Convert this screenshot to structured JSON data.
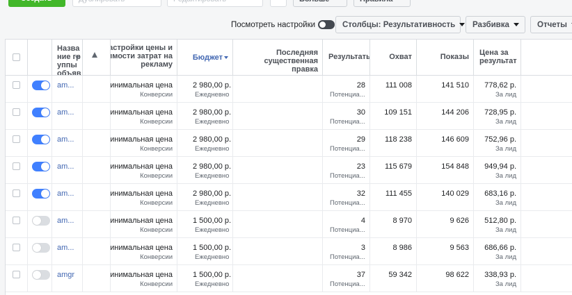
{
  "toolbar": {
    "create_label": "+ Создать",
    "duplicate_label": "Дублировать",
    "edit_label": "Редактировать",
    "more_label": "Больше",
    "rules_label": "Правила"
  },
  "view_settings_label": "Посмотреть настройки",
  "columns_button": "Столбцы: Результативность",
  "breakdown_button": "Разбивка",
  "reports_button": "Отчеты",
  "headers": {
    "name": "Название группы объявлений",
    "warning_icon": "warning-icon",
    "bid": "Настройки цены и стоимости затрат на рекламу",
    "budget": "Бюджет",
    "last_edit": "Последняя существенная правка",
    "results": "Результаты",
    "reach": "Охват",
    "impressions": "Показы",
    "cost_per_result": "Цена за результат"
  },
  "rows": [
    {
      "toggle": "on",
      "name": "am...",
      "bid": "Минимальная цена",
      "bid_sub": "Конверсии",
      "budget": "2 980,00 р.",
      "budget_sub": "Ежедневно",
      "results": "28",
      "results_sub": "Потенциа...",
      "reach": "111 008",
      "impressions": "141 510",
      "cpr": "778,62 р.",
      "cpr_sub": "За лид"
    },
    {
      "toggle": "on",
      "name": "am...",
      "bid": "Минимальная цена",
      "bid_sub": "Конверсии",
      "budget": "2 980,00 р.",
      "budget_sub": "Ежедневно",
      "results": "30",
      "results_sub": "Потенциа...",
      "reach": "109 151",
      "impressions": "144 206",
      "cpr": "728,95 р.",
      "cpr_sub": "За лид"
    },
    {
      "toggle": "on",
      "name": "am...",
      "bid": "Минимальная цена",
      "bid_sub": "Конверсии",
      "budget": "2 980,00 р.",
      "budget_sub": "Ежедневно",
      "results": "29",
      "results_sub": "Потенциа...",
      "reach": "118 238",
      "impressions": "146 609",
      "cpr": "752,96 р.",
      "cpr_sub": "За лид"
    },
    {
      "toggle": "on",
      "name": "am...",
      "bid": "Минимальная цена",
      "bid_sub": "Конверсии",
      "budget": "2 980,00 р.",
      "budget_sub": "Ежедневно",
      "results": "23",
      "results_sub": "Потенциа...",
      "reach": "115 679",
      "impressions": "154 848",
      "cpr": "949,94 р.",
      "cpr_sub": "За лид"
    },
    {
      "toggle": "on",
      "name": "am...",
      "bid": "Минимальная цена",
      "bid_sub": "Конверсии",
      "budget": "2 980,00 р.",
      "budget_sub": "Ежедневно",
      "results": "32",
      "results_sub": "Потенциа...",
      "reach": "111 455",
      "impressions": "140 029",
      "cpr": "683,16 р.",
      "cpr_sub": "За лид"
    },
    {
      "toggle": "off",
      "name": "am...",
      "bid": "Минимальная цена",
      "bid_sub": "Конверсии",
      "budget": "1 500,00 р.",
      "budget_sub": "Ежедневно",
      "results": "4",
      "results_sub": "Потенциа...",
      "reach": "8 970",
      "impressions": "9 626",
      "cpr": "512,80 р.",
      "cpr_sub": "За лид"
    },
    {
      "toggle": "off",
      "name": "am...",
      "bid": "Минимальная цена",
      "bid_sub": "Конверсии",
      "budget": "1 500,00 р.",
      "budget_sub": "Ежедневно",
      "results": "3",
      "results_sub": "Потенциа...",
      "reach": "8 986",
      "impressions": "9 563",
      "cpr": "686,66 р.",
      "cpr_sub": "За лид"
    },
    {
      "toggle": "off",
      "name": "amgr",
      "bid": "Минимальная цена",
      "bid_sub": "Конверсии",
      "budget": "1 500,00 р.",
      "budget_sub": "Ежедневно",
      "results": "37",
      "results_sub": "Потенциа...",
      "reach": "59 342",
      "impressions": "98 622",
      "cpr": "338,93 р.",
      "cpr_sub": "За лид"
    }
  ]
}
